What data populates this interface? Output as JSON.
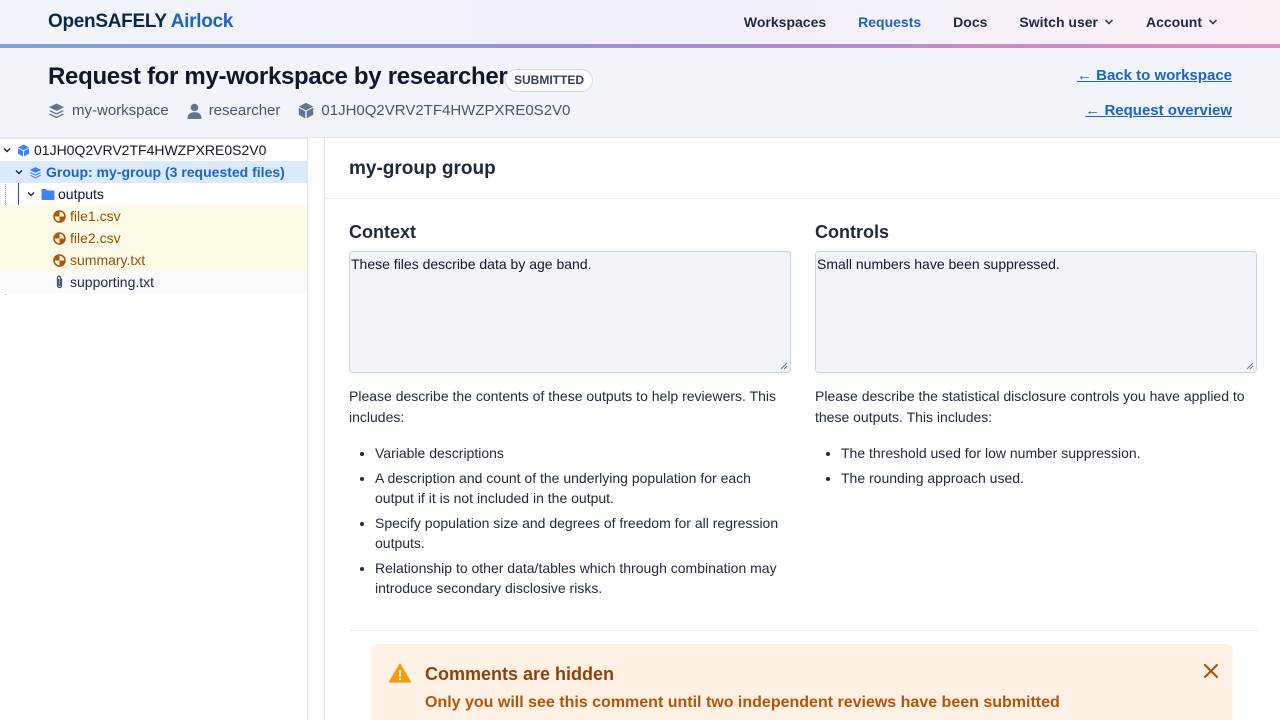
{
  "brand": {
    "part1": "OpenSAFELY",
    "part2": "Airlock"
  },
  "nav": {
    "workspaces": "Workspaces",
    "requests": "Requests",
    "docs": "Docs",
    "switch_user": "Switch user",
    "account": "Account"
  },
  "header": {
    "title": "Request for my-workspace by researcher",
    "status_badge": "SUBMITTED",
    "meta_workspace": "my-workspace",
    "meta_user": "researcher",
    "meta_request_id": "01JH0Q2VRV2TF4HWZPXRE0S2V0",
    "back_to_workspace": "← Back to workspace",
    "request_overview": "← Request overview"
  },
  "tree": {
    "root": "01JH0Q2VRV2TF4HWZPXRE0S2V0",
    "group": "Group: my-group (3 requested files)",
    "folder": "outputs",
    "files": [
      "file1.csv",
      "file2.csv",
      "summary.txt"
    ],
    "supporting": "supporting.txt"
  },
  "main": {
    "group_title": "my-group group",
    "context": {
      "heading": "Context",
      "value": "These files describe data by age band.",
      "help_intro": "Please describe the contents of these outputs to help reviewers. This includes:",
      "items": [
        "Variable descriptions",
        "A description and count of the underlying population for each output if it is not included in the output.",
        "Specify population size and degrees of freedom for all regression outputs.",
        "Relationship to other data/tables which through combination may introduce secondary disclosive risks."
      ]
    },
    "controls": {
      "heading": "Controls",
      "value": "Small numbers have been suppressed.",
      "help_intro": "Please describe the statistical disclosure controls you have applied to these outputs. This includes:",
      "items": [
        "The threshold used for low number suppression.",
        "The rounding approach used."
      ]
    },
    "alert": {
      "title": "Comments are hidden",
      "text": "Only you will see this comment until two independent reviews have been submitted"
    }
  },
  "colors": {
    "accent": "#1d64c0",
    "file_text": "#92520a",
    "alert_bg": "#fff2e4",
    "alert_title": "#92400e"
  }
}
